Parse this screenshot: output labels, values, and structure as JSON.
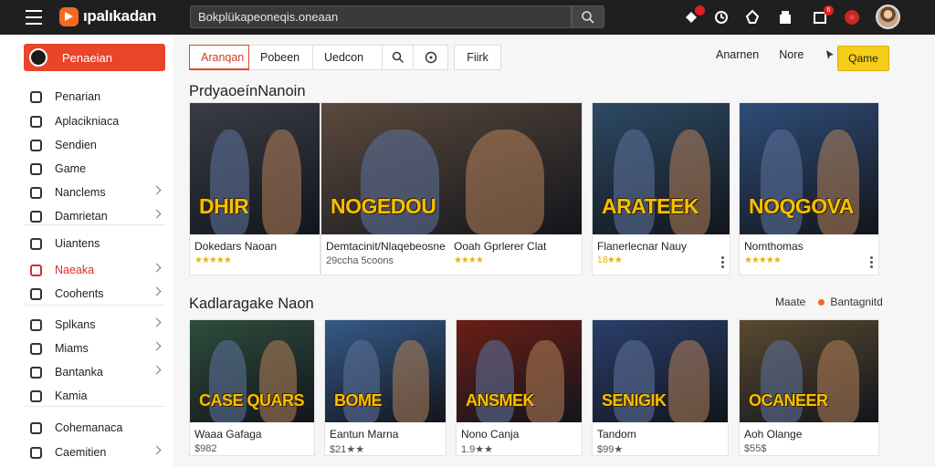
{
  "app": {
    "logo_text": "ıpalıkadan"
  },
  "search": {
    "value": "Bokplükapeoneqis.oneaan",
    "placeholder": ""
  },
  "topbar": {
    "notif_badge": "6"
  },
  "sidebar": {
    "main_label": "Penaeian",
    "items": [
      {
        "label": "Penarian",
        "icon": "video-icon"
      },
      {
        "label": "Aplacikniaca",
        "icon": "apps-icon"
      },
      {
        "label": "Sendien",
        "icon": "spade-icon"
      },
      {
        "label": "Game",
        "icon": "controller-icon"
      },
      {
        "label": "Nanclems",
        "icon": "grid-icon"
      },
      {
        "label": "Damrietan",
        "icon": "puzzle-icon"
      },
      {
        "label": "Uiantens",
        "icon": "box-icon"
      },
      {
        "label": "Naeaka",
        "icon": "rocket-icon"
      },
      {
        "label": "Coohents",
        "icon": "cube-icon"
      },
      {
        "label": "Splkans",
        "icon": "sword-icon"
      },
      {
        "label": "Miams",
        "icon": "user-icon"
      },
      {
        "label": "Bantanka",
        "icon": "doc-icon"
      },
      {
        "label": "Kamia",
        "icon": "flag-icon"
      },
      {
        "label": "Cohemanaca",
        "icon": "keyboard-icon"
      },
      {
        "label": "Caemitien",
        "icon": "disc-icon"
      }
    ]
  },
  "tabs": [
    {
      "label": "Aranqan"
    },
    {
      "label": "Pobeen"
    },
    {
      "label": "Uedcon"
    },
    {
      "label": "",
      "icon": "search-icon"
    },
    {
      "label": "",
      "icon": "refresh-icon"
    },
    {
      "label": "Fiirk"
    }
  ],
  "toolbar": {
    "link1": "Anarnen",
    "link2": "Nore",
    "yellow_btn": "Qame"
  },
  "section1": {
    "title": "PrdyaoeínNanoin",
    "cards": [
      {
        "title": "Dokedars Naoan",
        "sub": "",
        "rating": "★★★★★",
        "thumb_text": "DHIR",
        "thumb_color": "#3a3d44"
      },
      {
        "title": "Demtacinit/Nlaqebeosne",
        "sub": "29ccha 5coons",
        "rating": "",
        "thumb_text": "NOGEDOU",
        "thumb_color": "#5b4a3d"
      },
      {
        "title": "Ooah Gprlerer Clat",
        "sub": "",
        "rating": "★★★★",
        "thumb_text": "",
        "thumb_color": "#4a4f5d"
      },
      {
        "title": "Flanerlecnar Nauy",
        "sub": "",
        "rating": "1.8★★",
        "thumb_text": "ARATEEK",
        "thumb_color": "#2d4a64"
      },
      {
        "title": "Nomthomas",
        "sub": "",
        "rating": "★★★★★",
        "thumb_text": "NOQGOVA",
        "thumb_color": "#2f4d78"
      }
    ]
  },
  "section2": {
    "title": "Kadlaragake Naon",
    "right_label": "Maate",
    "right_label2": "Bantagnitd",
    "cards": [
      {
        "title": "Waaa Gafaga",
        "price": "$982",
        "thumb_text": "CASE QUARS",
        "thumb_color": "#2e4d3c"
      },
      {
        "title": "Eantun Marna",
        "price": "$21★★",
        "thumb_text": "BOME",
        "thumb_color": "#355a88"
      },
      {
        "title": "Nono Canja",
        "price": "1.9★★",
        "thumb_text": "ANSMEK",
        "thumb_color": "#6a1e16"
      },
      {
        "title": "Tandom",
        "price": "$99★",
        "thumb_text": "SENIGIK",
        "thumb_color": "#2a3f6a"
      },
      {
        "title": "Aoh Olange",
        "price": "$55$",
        "thumb_text": "OCANEER",
        "thumb_color": "#5a4a30"
      }
    ]
  }
}
